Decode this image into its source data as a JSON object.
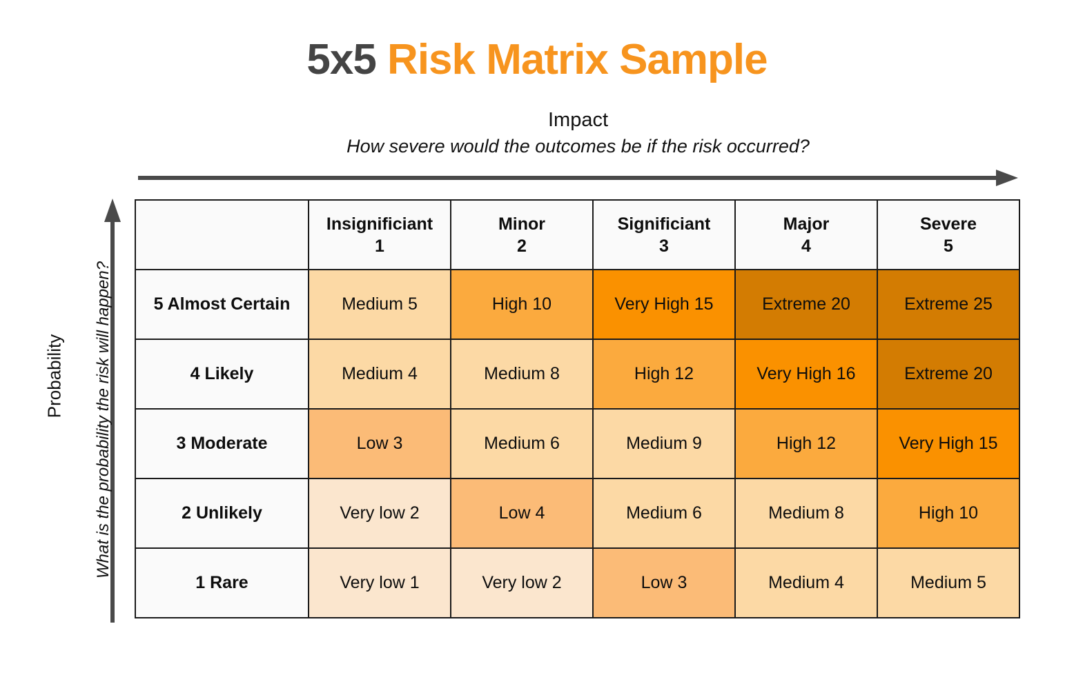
{
  "title": {
    "prefix": "5x5",
    "rest": "Risk Matrix Sample",
    "prefix_color": "#444444",
    "rest_color": "#F7941E"
  },
  "impact_axis": {
    "label": "Impact",
    "question": "How severe would the outcomes be if the risk occurred?",
    "arrow": "right-arrow-icon"
  },
  "probability_axis": {
    "label": "Probability",
    "question": "What is the probability the risk will happen?",
    "arrow": "up-arrow-icon"
  },
  "matrix": {
    "corner": "",
    "columns": [
      {
        "name": "Insignificiant",
        "level": "1"
      },
      {
        "name": "Minor",
        "level": "2"
      },
      {
        "name": "Significiant",
        "level": "3"
      },
      {
        "name": "Major",
        "level": "4"
      },
      {
        "name": "Severe",
        "level": "5"
      }
    ],
    "rows": [
      {
        "label": "5 Almost Certain",
        "cells": [
          {
            "text": "Medium 5",
            "severity": "Medium",
            "score": 5,
            "color": "#FBD091"
          },
          {
            "text": "High 10",
            "severity": "High",
            "score": 10,
            "color": "#FBAA3E"
          },
          {
            "text": "Very High 15",
            "severity": "Very High",
            "score": 15,
            "color": "#FA9100"
          },
          {
            "text": "Extreme 20",
            "severity": "Extreme",
            "score": 20,
            "color": "#D37C02"
          },
          {
            "text": "Extreme 25",
            "severity": "Extreme",
            "score": 25,
            "color": "#D37C02"
          }
        ]
      },
      {
        "label": "4 Likely",
        "cells": [
          {
            "text": "Medium 4",
            "severity": "Medium",
            "score": 4,
            "color": "#FCD9A5"
          },
          {
            "text": "Medium 8",
            "severity": "Medium",
            "score": 8,
            "color": "#FCD9A5"
          },
          {
            "text": "High 12",
            "severity": "High",
            "score": 12,
            "color": "#FBB košmar"
          },
          {
            "text": "Very High 16",
            "severity": "Very High",
            "score": 16,
            "color": "#FA9100"
          },
          {
            "text": "Extreme 20",
            "severity": "Extreme",
            "score": 20,
            "color": "#D37C02"
          }
        ]
      },
      {
        "label": "3 Moderate",
        "cells": [
          {
            "text": "Low 3",
            "severity": "Low",
            "score": 3,
            "color": "#FBBB77"
          },
          {
            "text": "Medium 6",
            "severity": "Medium",
            "score": 6,
            "color": "#FCD9A5"
          },
          {
            "text": "Medium 9",
            "severity": "Medium",
            "score": 9,
            "color": "#FCD9A5"
          },
          {
            "text": "High 12",
            "severity": "High",
            "score": 12,
            "color": "#FBAA3E"
          },
          {
            "text": "Very High 15",
            "severity": "Very High",
            "score": 15,
            "color": "#FA9100"
          }
        ]
      },
      {
        "label": "2 Unlikely",
        "cells": [
          {
            "text": "Very low 2",
            "severity": "Very low",
            "score": 2,
            "color": "#FBE6CE"
          },
          {
            "text": "Low 4",
            "severity": "Low",
            "score": 4,
            "color": "#FBBB77"
          },
          {
            "text": "Medium 6",
            "severity": "Medium",
            "score": 6,
            "color": "#FCD9A5"
          },
          {
            "text": "Medium 8",
            "severity": "Medium",
            "score": 8,
            "color": "#FCD9A5"
          },
          {
            "text": "High 10",
            "severity": "High",
            "score": 10,
            "color": "#FBAA3E"
          }
        ]
      },
      {
        "label": "1 Rare",
        "cells": [
          {
            "text": "Very low 1",
            "severity": "Very low",
            "score": 1,
            "color": "#FBE6CE"
          },
          {
            "text": "Very low 2",
            "severity": "Very low",
            "score": 2,
            "color": "#FBE6CE"
          },
          {
            "text": "Low 3",
            "severity": "Low",
            "score": 3,
            "color": "#FBBB77"
          },
          {
            "text": "Medium 4",
            "severity": "Medium",
            "score": 4,
            "color": "#FCD9A5"
          },
          {
            "text": "Medium 5",
            "severity": "Medium",
            "score": 5,
            "color": "#FCD9A5"
          }
        ]
      }
    ]
  },
  "chart_data": {
    "type": "heatmap",
    "title": "5x5 Risk Matrix Sample",
    "xlabel": "Impact",
    "ylabel": "Probability",
    "x_categories": [
      "Insignificiant 1",
      "Minor 2",
      "Significiant 3",
      "Major 4",
      "Severe 5"
    ],
    "y_categories": [
      "5 Almost Certain",
      "4 Likely",
      "3 Moderate",
      "2 Unlikely",
      "1 Rare"
    ],
    "values": [
      [
        5,
        10,
        15,
        20,
        25
      ],
      [
        4,
        8,
        12,
        16,
        20
      ],
      [
        3,
        6,
        9,
        12,
        15
      ],
      [
        2,
        4,
        6,
        8,
        10
      ],
      [
        1,
        2,
        3,
        4,
        5
      ]
    ],
    "labels": [
      [
        "Medium 5",
        "High 10",
        "Very High 15",
        "Extreme 20",
        "Extreme 25"
      ],
      [
        "Medium 4",
        "Medium 8",
        "High 12",
        "Very High 16",
        "Extreme 20"
      ],
      [
        "Low 3",
        "Medium 6",
        "Medium 9",
        "High 12",
        "Very High 15"
      ],
      [
        "Very low 2",
        "Low 4",
        "Medium 6",
        "Medium 8",
        "High 10"
      ],
      [
        "Very low 1",
        "Very low 2",
        "Low 3",
        "Medium 4",
        "Medium 5"
      ]
    ],
    "severity_colors": {
      "Very low": "#FBE6CE",
      "Low": "#FBBB77",
      "Medium": "#FCD9A5",
      "High": "#FBAA3E",
      "Very High": "#FA9100",
      "Extreme": "#D37C02"
    },
    "grid": true,
    "legend": "none"
  }
}
